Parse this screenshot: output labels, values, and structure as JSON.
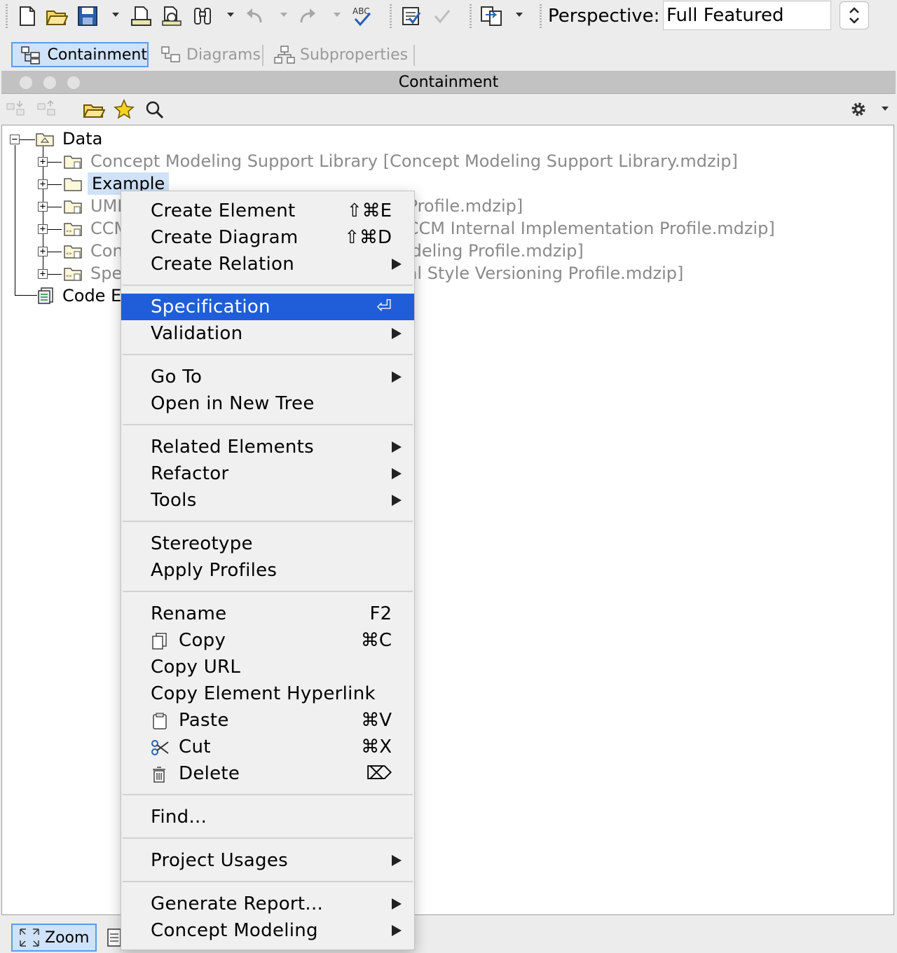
{
  "toolbar": {
    "icons": [
      "new-file-icon",
      "open-folder-icon",
      "save-icon",
      "save-dropdown-icon",
      "print-icon",
      "print-preview-icon",
      "binoculars-icon",
      "find-dropdown-icon",
      "undo-icon",
      "undo-dropdown-icon",
      "redo-icon",
      "redo-dropdown-icon",
      "spell-check-icon",
      "validate-icon",
      "checkmark-icon",
      "compare-icon",
      "compare-dropdown-icon"
    ],
    "perspective_label": "Perspective:",
    "perspective_value": "Full Featured"
  },
  "tabs": [
    {
      "label": "Containment",
      "icon": "containment-tree-icon",
      "active": true
    },
    {
      "label": "Diagrams",
      "icon": "diagrams-icon",
      "active": false
    },
    {
      "label": "Subproperties",
      "icon": "subproperties-icon",
      "active": false
    }
  ],
  "panel": {
    "title": "Containment",
    "toolbar_icons": [
      "collapse-icon",
      "expand-icon",
      "open-folder-icon",
      "star-icon",
      "search-icon",
      "gear-icon",
      "dropdown-icon"
    ]
  },
  "tree": {
    "root": "Data",
    "items": [
      {
        "label": "Concept Modeling Support Library [Concept Modeling Support Library.mdzip]",
        "dim": true
      },
      {
        "label": "Example",
        "dim": false,
        "selected": true
      },
      {
        "label": "UML Standard Profile [UML_Standard_Profile.mdzip]",
        "dim": true
      },
      {
        "label": "CCM Internal Implementation Profile [CCM Internal Implementation Profile.mdzip]",
        "dim": true
      },
      {
        "label": "Concept Modeling Profile [Concept Modeling Profile.mdzip]",
        "dim": true
      },
      {
        "label": "Special Style Versioning Profile [Special Style Versioning Profile.mdzip]",
        "dim": true
      }
    ],
    "code_engineering": "Code Engineering Sets"
  },
  "context_menu": {
    "create_element": "Create Element",
    "create_element_sc": "⇧⌘E",
    "create_diagram": "Create Diagram",
    "create_diagram_sc": "⇧⌘D",
    "create_relation": "Create Relation",
    "specification": "Specification",
    "specification_sc": "⏎",
    "validation": "Validation",
    "go_to": "Go To",
    "open_new_tree": "Open in New Tree",
    "related_elements": "Related Elements",
    "refactor": "Refactor",
    "tools": "Tools",
    "stereotype": "Stereotype",
    "apply_profiles": "Apply Profiles",
    "rename": "Rename",
    "rename_sc": "F2",
    "copy": "Copy",
    "copy_sc": "⌘C",
    "copy_url": "Copy URL",
    "copy_hyperlink": "Copy Element Hyperlink",
    "paste": "Paste",
    "paste_sc": "⌘V",
    "cut": "Cut",
    "cut_sc": "⌘X",
    "delete": "Delete",
    "delete_sc": "⌦",
    "find": "Find...",
    "project_usages": "Project Usages",
    "generate_report": "Generate Report...",
    "concept_modeling": "Concept Modeling"
  },
  "bottom": {
    "zoom_label": "Zoom"
  }
}
